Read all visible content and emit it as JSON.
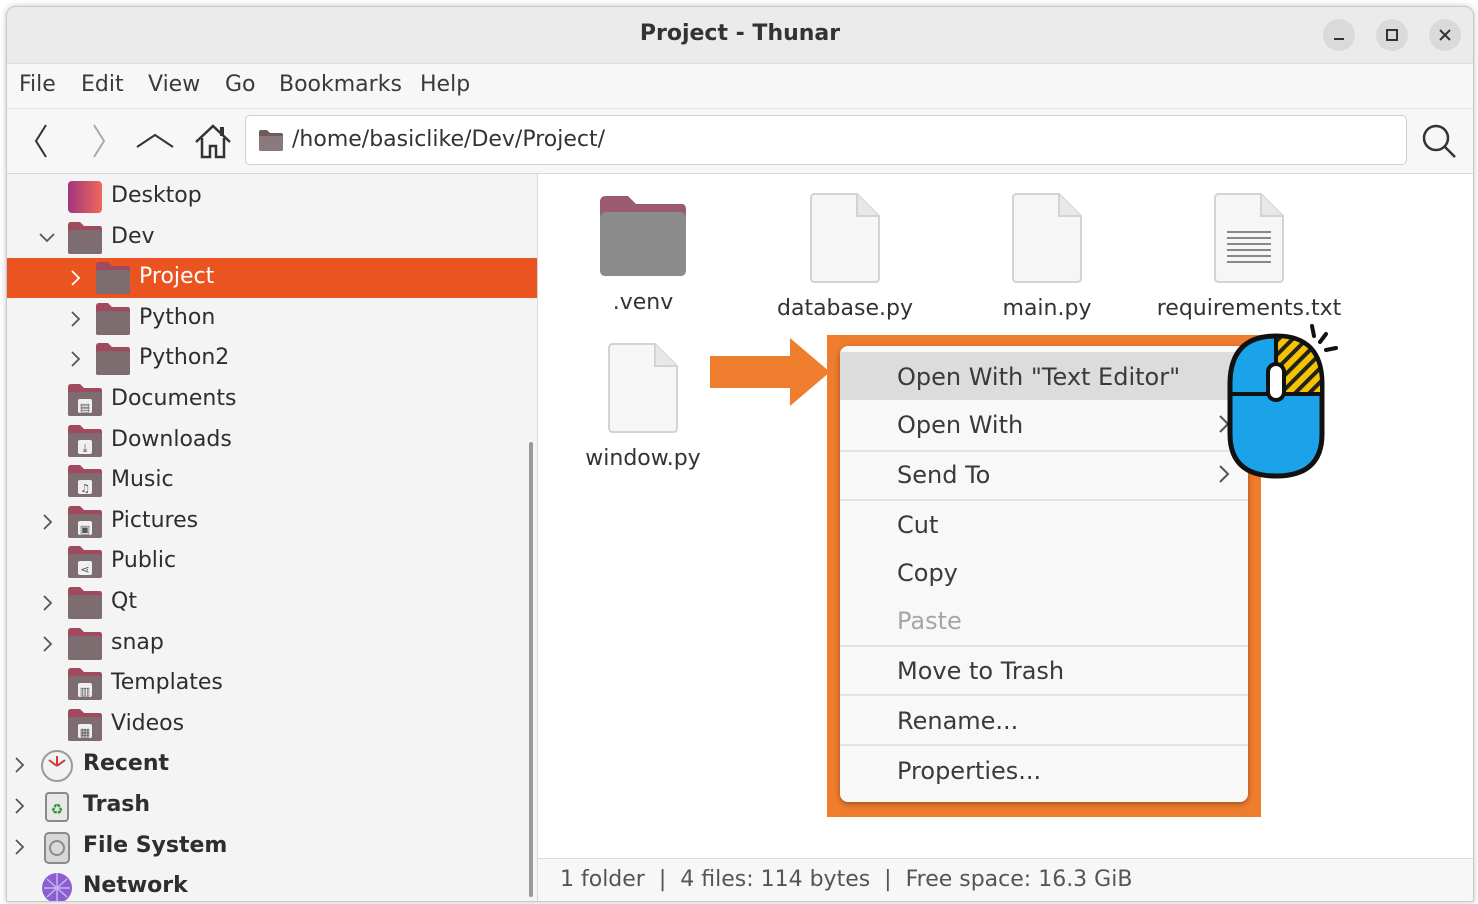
{
  "window": {
    "title": "Project - Thunar"
  },
  "menu": [
    "File",
    "Edit",
    "View",
    "Go",
    "Bookmarks",
    "Help"
  ],
  "location": {
    "path": "/home/basiclike/Dev/Project/"
  },
  "sidebar": {
    "items": [
      {
        "label": "Desktop",
        "level": 1,
        "icon": "desktop-folder-icon"
      },
      {
        "label": "Dev",
        "level": 1,
        "expanded": true,
        "icon": "folder-icon"
      },
      {
        "label": "Project",
        "level": 2,
        "selected": true,
        "icon": "folder-icon"
      },
      {
        "label": "Python",
        "level": 2,
        "icon": "folder-icon"
      },
      {
        "label": "Python2",
        "level": 2,
        "icon": "folder-icon"
      },
      {
        "label": "Documents",
        "level": 1,
        "icon": "documents-folder-icon"
      },
      {
        "label": "Downloads",
        "level": 1,
        "icon": "downloads-folder-icon"
      },
      {
        "label": "Music",
        "level": 1,
        "icon": "music-folder-icon"
      },
      {
        "label": "Pictures",
        "level": 1,
        "icon": "pictures-folder-icon"
      },
      {
        "label": "Public",
        "level": 1,
        "icon": "public-folder-icon"
      },
      {
        "label": "Qt",
        "level": 1,
        "icon": "folder-icon"
      },
      {
        "label": "snap",
        "level": 1,
        "icon": "folder-icon"
      },
      {
        "label": "Templates",
        "level": 1,
        "icon": "templates-folder-icon"
      },
      {
        "label": "Videos",
        "level": 1,
        "icon": "videos-folder-icon"
      },
      {
        "label": "Recent",
        "level": 0,
        "icon": "recent-icon"
      },
      {
        "label": "Trash",
        "level": 0,
        "icon": "trash-icon"
      },
      {
        "label": "File System",
        "level": 0,
        "icon": "drive-icon"
      },
      {
        "label": "Network",
        "level": 0,
        "icon": "network-icon"
      }
    ]
  },
  "files": [
    {
      "name": ".venv",
      "type": "folder"
    },
    {
      "name": "database.py",
      "type": "file"
    },
    {
      "name": "main.py",
      "type": "file"
    },
    {
      "name": "requirements.txt",
      "type": "text"
    },
    {
      "name": "window.py",
      "type": "file"
    }
  ],
  "context_menu": {
    "items": [
      {
        "label": "Open With \"Text Editor\"",
        "hover": true
      },
      {
        "label": "Open With",
        "submenu": true
      },
      {
        "label": "Send To",
        "submenu": true
      },
      {
        "label": "Cut"
      },
      {
        "label": "Copy"
      },
      {
        "label": "Paste",
        "disabled": true
      },
      {
        "label": "Move to Trash"
      },
      {
        "label": "Rename..."
      },
      {
        "label": "Properties..."
      }
    ]
  },
  "status": {
    "text": "1 folder  |  4 files: 114 bytes  |  Free space: 16.3 GiB"
  },
  "colors": {
    "accent": "#e95420",
    "highlight": "#ef7d2e",
    "mouse": "#1aa3e8"
  }
}
